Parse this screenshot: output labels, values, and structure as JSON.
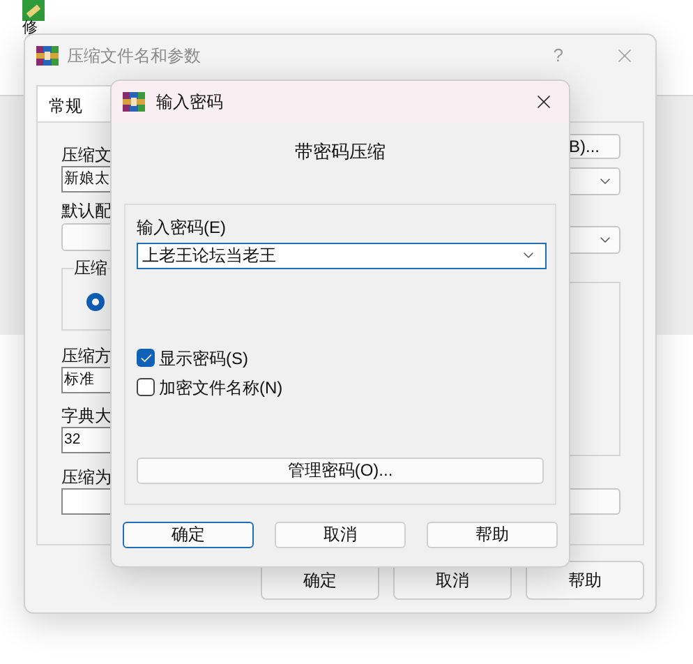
{
  "desktop_icon": {
    "label": "修"
  },
  "background_window": {
    "title": "压缩文件名和参数",
    "help": "?",
    "tabs": [
      {
        "label": "常规",
        "selected": true
      }
    ],
    "left_items": [
      {
        "kind": "label",
        "text": "压缩文"
      },
      {
        "kind": "field",
        "text": "新娘太"
      },
      {
        "kind": "label",
        "text": "默认配"
      },
      {
        "kind": "dropdown"
      },
      {
        "kind": "group",
        "text": "压缩",
        "radio_selected": true
      },
      {
        "kind": "label",
        "text": "压缩方"
      },
      {
        "kind": "field",
        "text": "标准"
      },
      {
        "kind": "label",
        "text": "字典大"
      },
      {
        "kind": "field",
        "text": "32"
      },
      {
        "kind": "label",
        "text": "压缩为"
      },
      {
        "kind": "field"
      }
    ],
    "right_items": [
      {
        "kind": "button",
        "text": "B)..."
      },
      {
        "kind": "dropdown"
      },
      {
        "kind": "dropdown"
      },
      {
        "kind": "group"
      },
      {
        "kind": "field"
      }
    ],
    "buttons": [
      "确定",
      "取消",
      "帮助"
    ]
  },
  "dialog": {
    "title": "输入密码",
    "heading": "带密码压缩",
    "password_label": "输入密码(E)",
    "password_value": "上老王论坛当老王",
    "options": [
      {
        "label": "显示密码(S)",
        "checked": true
      },
      {
        "label": "加密文件名称(N)",
        "checked": false
      }
    ],
    "manage_button": "管理密码(O)...",
    "buttons": [
      {
        "label": "确定",
        "default": true
      },
      {
        "label": "取消",
        "default": false
      },
      {
        "label": "帮助",
        "default": false
      }
    ]
  }
}
